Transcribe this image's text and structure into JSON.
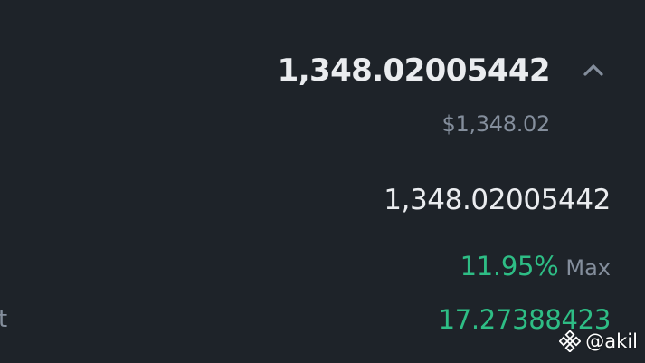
{
  "balance": {
    "total": "1,348.02005442",
    "usd_value": "$1,348.02"
  },
  "details": {
    "amount": "1,348.02005442",
    "apr": "11.95%",
    "max_label": "Max",
    "reward": "17.27388423",
    "left_label_partial": "t"
  },
  "watermark": {
    "handle": "@akil"
  },
  "colors": {
    "background": "#1e2329",
    "primary_text": "#eaecef",
    "secondary_text": "#848e9c",
    "positive": "#2ebd85"
  },
  "icons": {
    "toggle": "chevron-up-icon",
    "watermark_logo": "binance-logo-icon"
  }
}
